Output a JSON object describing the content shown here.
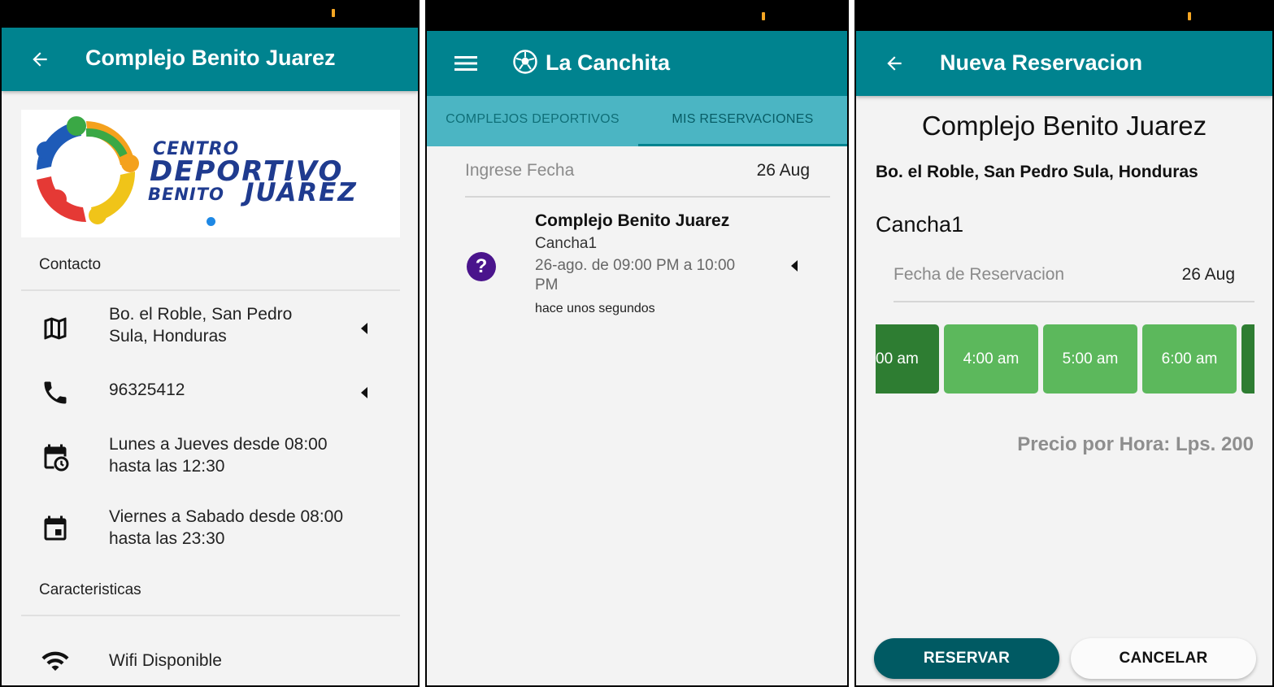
{
  "screen1": {
    "title": "Complejo Benito Juarez",
    "logo": {
      "line1": "CENTRO",
      "line2": "DEPORTIVO",
      "line3a": "BENITO",
      "line3b": "JUÁREZ"
    },
    "contact_label": "Contacto",
    "address_line1": "Bo. el Roble, San Pedro",
    "address_line2": "Sula, Honduras",
    "phone": "96325412",
    "schedule1_line1": "Lunes a Jueves desde 08:00",
    "schedule1_line2": "hasta las 12:30",
    "schedule2_line1": "Viernes a Sabado desde 08:00",
    "schedule2_line2": "hasta las 23:30",
    "features_label": "Caracteristicas",
    "wifi": "Wifi Disponible",
    "icons": [
      "back-arrow-icon",
      "map-icon",
      "phone-icon",
      "calendar-clock-icon",
      "calendar-icon",
      "wifi-icon",
      "expand-caret-icon"
    ]
  },
  "screen2": {
    "title": "La Canchita",
    "tabs": [
      "COMPLEJOS DEPORTIVOS",
      "MIS RESERVACIONES"
    ],
    "active_tab": 1,
    "date_label": "Ingrese Fecha",
    "date_value": "26 Aug",
    "reservation": {
      "complex": "Complejo Benito Juarez",
      "court": "Cancha1",
      "time_line1": "26-ago. de 09:00 PM a 10:00",
      "time_line2": "PM",
      "ago": "hace unos segundos",
      "status_symbol": "?"
    },
    "icons": [
      "menu-icon",
      "soccer-ball-icon",
      "help-icon",
      "expand-caret-icon"
    ]
  },
  "screen3": {
    "title": "Nueva Reservacion",
    "complex": "Complejo Benito Juarez",
    "address": "Bo. el Roble, San Pedro Sula, Honduras",
    "court": "Cancha1",
    "date_label": "Fecha de Reservacion",
    "date_value": "26 Aug",
    "slots": [
      "00 am",
      "4:00 am",
      "5:00 am",
      "6:00 am"
    ],
    "price": "Precio por Hora: Lps. 200",
    "reserve_button": "RESERVAR",
    "cancel_button": "CANCELAR"
  },
  "colors": {
    "appbar": "#00838f",
    "tabs_bg": "#4bb5c3",
    "slot_available": "#5cb85c",
    "slot_selected": "#2e7d32",
    "primary_button": "#005a63",
    "status_accent": "#f5a623",
    "help_badge": "#4a148c"
  }
}
